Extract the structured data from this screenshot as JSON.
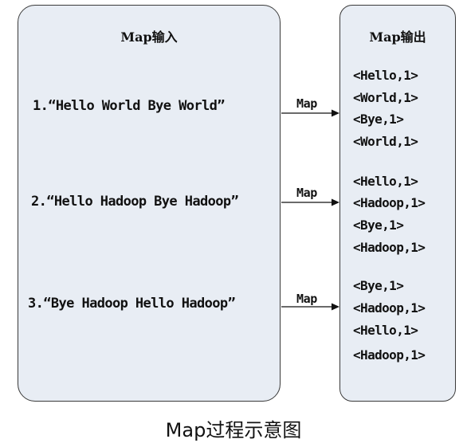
{
  "input_panel": {
    "title": "Map输入",
    "lines": [
      "1.“Hello World Bye World”",
      "2.“Hello Hadoop Bye Hadoop”",
      "3.“Bye Hadoop Hello Hadoop”"
    ]
  },
  "output_panel": {
    "title": "Map输出",
    "groups": [
      [
        "<Hello,1>",
        "<World,1>",
        "<Bye,1>",
        "<World,1>"
      ],
      [
        "<Hello,1>",
        "<Hadoop,1>",
        "<Bye,1>",
        "<Hadoop,1>"
      ],
      [
        "<Bye,1>",
        "<Hadoop,1>",
        "<Hello,1>",
        "<Hadoop,1>"
      ]
    ]
  },
  "arrows": [
    {
      "label": "Map"
    },
    {
      "label": "Map"
    },
    {
      "label": "Map"
    }
  ],
  "caption": "Map过程示意图"
}
